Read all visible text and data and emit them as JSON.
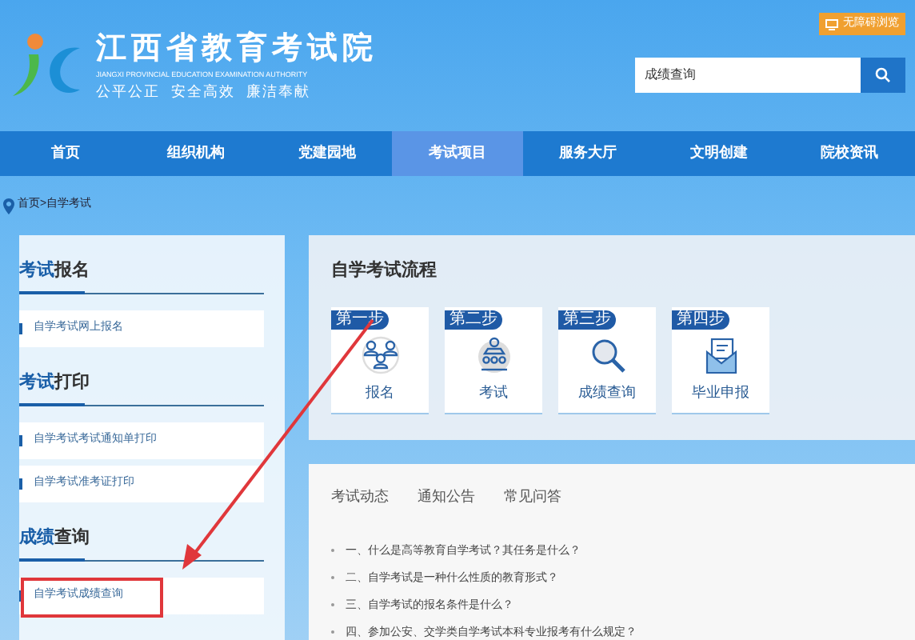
{
  "header": {
    "title": "江西省教育考试院",
    "subtitle": "JIANGXI PROVINCIAL EDUCATION EXAMINATION AUTHORITY",
    "motto": "公平公正  安全高效  廉洁奉献",
    "accessibility_button": "无障碍浏览",
    "search": {
      "value": "成绩查询"
    }
  },
  "nav": [
    {
      "label": "首页",
      "selected": false
    },
    {
      "label": "组织机构",
      "selected": false
    },
    {
      "label": "党建园地",
      "selected": false
    },
    {
      "label": "考试项目",
      "selected": true
    },
    {
      "label": "服务大厅",
      "selected": false
    },
    {
      "label": "文明创建",
      "selected": false
    },
    {
      "label": "院校资讯",
      "selected": false
    }
  ],
  "breadcrumb": "首页>自学考试",
  "sidebar": [
    {
      "title_accent": "考试",
      "title_rest": "报名",
      "items": [
        {
          "label": "自学考试网上报名",
          "highlighted": false
        }
      ]
    },
    {
      "title_accent": "考试",
      "title_rest": "打印",
      "items": [
        {
          "label": "自学考试考试通知单打印",
          "highlighted": false
        },
        {
          "label": "自学考试准考证打印",
          "highlighted": false
        }
      ]
    },
    {
      "title_accent": "成绩",
      "title_rest": "查询",
      "items": [
        {
          "label": "自学考试成绩查询",
          "highlighted": true
        }
      ]
    }
  ],
  "process": {
    "title": "自学考试流程",
    "steps": [
      {
        "badge": "第一步",
        "label": "报名",
        "kind": "people"
      },
      {
        "badge": "第二步",
        "label": "考试",
        "kind": "exam"
      },
      {
        "badge": "第三步",
        "label": "成绩查询",
        "kind": "search"
      },
      {
        "badge": "第四步",
        "label": "毕业申报",
        "kind": "mail"
      }
    ]
  },
  "news": {
    "tabs": [
      "考试动态",
      "通知公告",
      "常见问答"
    ],
    "items": [
      "一、什么是高等教育自学考试？其任务是什么？",
      "二、自学考试是一种什么性质的教育形式？",
      "三、自学考试的报名条件是什么？",
      "四、参加公安、交学类自学考试本科专业报考有什么规定？"
    ]
  }
}
